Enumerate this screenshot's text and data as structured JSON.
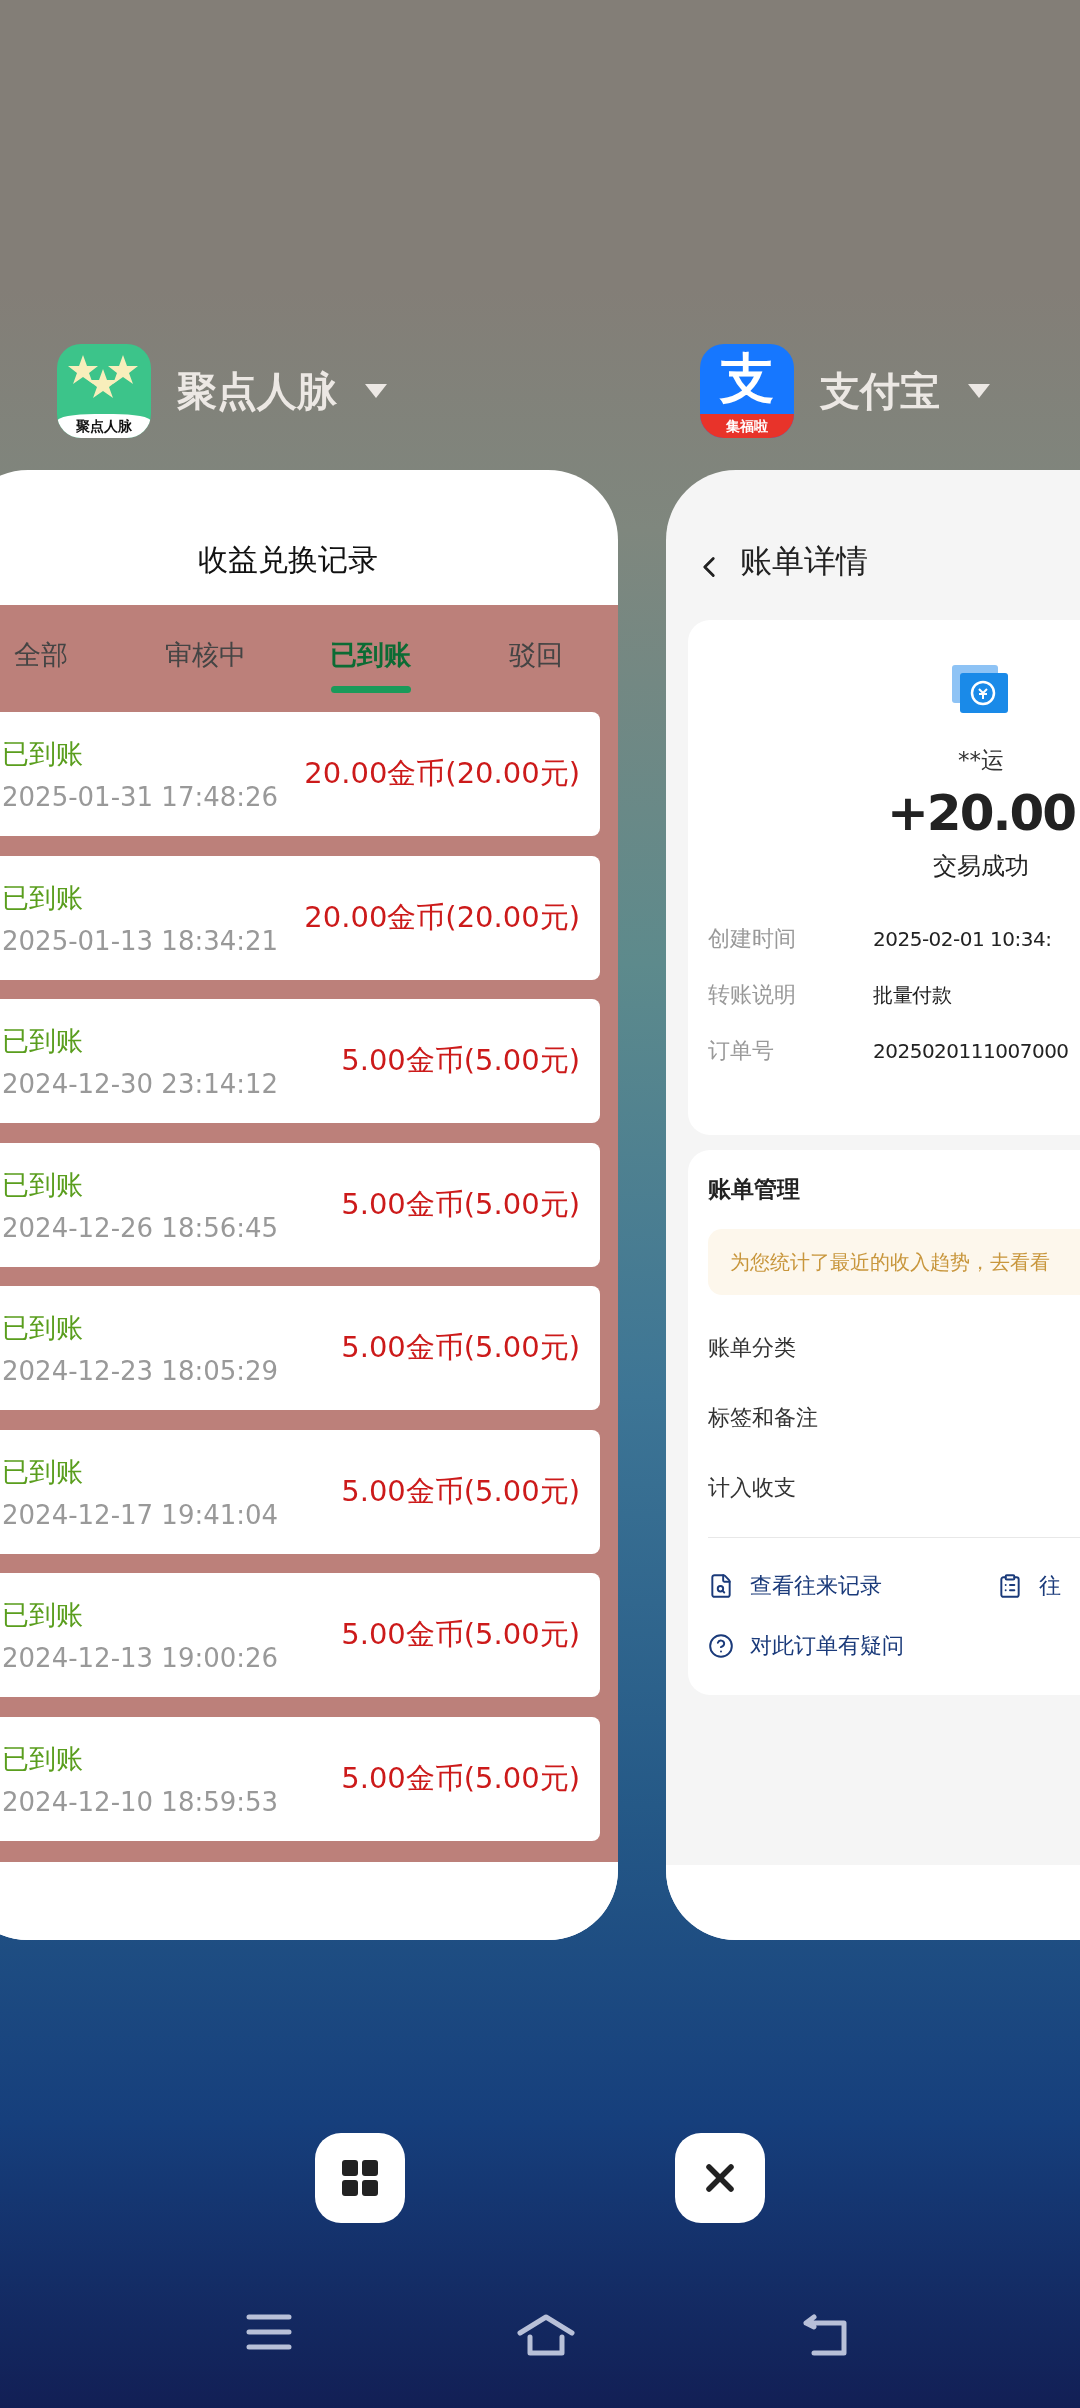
{
  "apps": [
    {
      "kind": "records",
      "name": "聚点人脉",
      "icon_text": "聚点人脉",
      "page": {
        "title": "收益兑换记录",
        "tabs": [
          {
            "label": "全部",
            "selected": false
          },
          {
            "label": "审核中",
            "selected": false
          },
          {
            "label": "已到账",
            "selected": true
          },
          {
            "label": "驳回",
            "selected": false
          }
        ],
        "records": [
          {
            "status": "已到账",
            "time": "2025-01-31 17:48:26",
            "amount": "20.00金币(20.00元)"
          },
          {
            "status": "已到账",
            "time": "2025-01-13 18:34:21",
            "amount": "20.00金币(20.00元)"
          },
          {
            "status": "已到账",
            "time": "2024-12-30 23:14:12",
            "amount": "5.00金币(5.00元)"
          },
          {
            "status": "已到账",
            "time": "2024-12-26 18:56:45",
            "amount": "5.00金币(5.00元)"
          },
          {
            "status": "已到账",
            "time": "2024-12-23 18:05:29",
            "amount": "5.00金币(5.00元)"
          },
          {
            "status": "已到账",
            "time": "2024-12-17 19:41:04",
            "amount": "5.00金币(5.00元)"
          },
          {
            "status": "已到账",
            "time": "2024-12-13 19:00:26",
            "amount": "5.00金币(5.00元)"
          },
          {
            "status": "已到账",
            "time": "2024-12-10 18:59:53",
            "amount": "5.00金币(5.00元)"
          }
        ]
      }
    },
    {
      "kind": "bill",
      "name": "支付宝",
      "icon_text": "支",
      "icon_badge": "集福啦",
      "page": {
        "title": "账单详情",
        "payee": "**运",
        "amount": "+20.00",
        "status": "交易成功",
        "details": [
          {
            "label": "创建时间",
            "value": "2025-02-01 10:34:"
          },
          {
            "label": "转账说明",
            "value": "批量付款"
          },
          {
            "label": "订单号",
            "value": "2025020111007000"
          }
        ],
        "section_title": "账单管理",
        "banner": "为您统计了最近的收入趋势，去看看",
        "menu": [
          "账单分类",
          "标签和备注",
          "计入收支"
        ],
        "links": [
          [
            {
              "kind": "history",
              "label": "查看往来记录"
            },
            {
              "kind": "list",
              "label": "往"
            }
          ],
          [
            {
              "kind": "question",
              "label": "对此订单有疑问"
            }
          ]
        ]
      }
    }
  ]
}
